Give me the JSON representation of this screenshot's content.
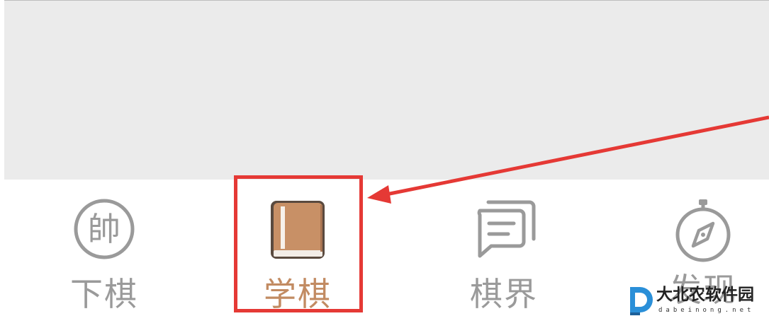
{
  "tab_bar": {
    "tabs": [
      {
        "id": "play",
        "label": "下棋",
        "icon": "shuai-chess-piece-icon",
        "active": false
      },
      {
        "id": "learn",
        "label": "学棋",
        "icon": "book-icon",
        "active": true
      },
      {
        "id": "world",
        "label": "棋界",
        "icon": "chat-bubbles-icon",
        "active": false
      },
      {
        "id": "discover",
        "label": "发现",
        "icon": "compass-icon",
        "active": false
      }
    ],
    "play_icon_glyph": "帥"
  },
  "colors": {
    "inactive": "#9a9a9a",
    "active_label": "#c28b62",
    "active_icon": "#c89066",
    "annotation_red": "#e53935",
    "content_bg": "#ebebeb"
  },
  "watermark": {
    "name": "大北农软件园",
    "domain": "dabeinong.net"
  }
}
